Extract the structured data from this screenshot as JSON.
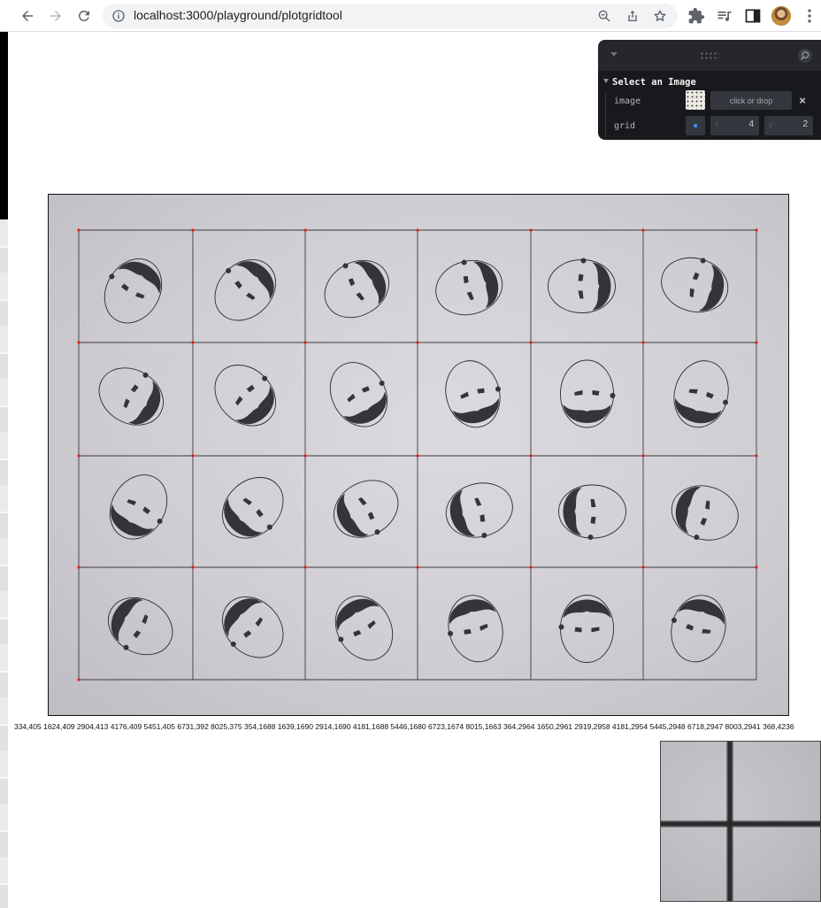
{
  "browser": {
    "url": "localhost:3000/playground/plotgridtool"
  },
  "panel": {
    "folder_title": "Select an Image",
    "image_label": "image",
    "drop_label": "click or drop",
    "clear_label": "×",
    "grid_label": "grid",
    "grid_x_axis": "x",
    "grid_x_value": "4",
    "grid_y_axis": "y",
    "grid_y_value": "2"
  },
  "coordinates_text": "334,405 1624,409 2904,413 4176,409 5451,405 6731,392 8025,375 354,1688 1639,1690 2914,1690 4181,1688 5446,1680 6723,1674 8015,1663 364,2964 1650,2961 2919,2958 4181,2954 5445,2948 6718,2947 8003,2941 368,4236",
  "icons": {
    "back": "arrow-left-icon",
    "forward": "arrow-right-icon",
    "reload": "reload-icon",
    "info": "info-icon",
    "zoom": "zoom-out-icon",
    "share": "share-icon",
    "bookmark": "star-icon",
    "extensions": "puzzle-icon",
    "media": "media-queue-icon",
    "sidepanel": "side-panel-icon",
    "menu": "kebab-menu-icon"
  },
  "colors": {
    "panel_bg": "#18191d",
    "panel_accent": "#3d8bfd",
    "grid_marker": "#e02020"
  }
}
